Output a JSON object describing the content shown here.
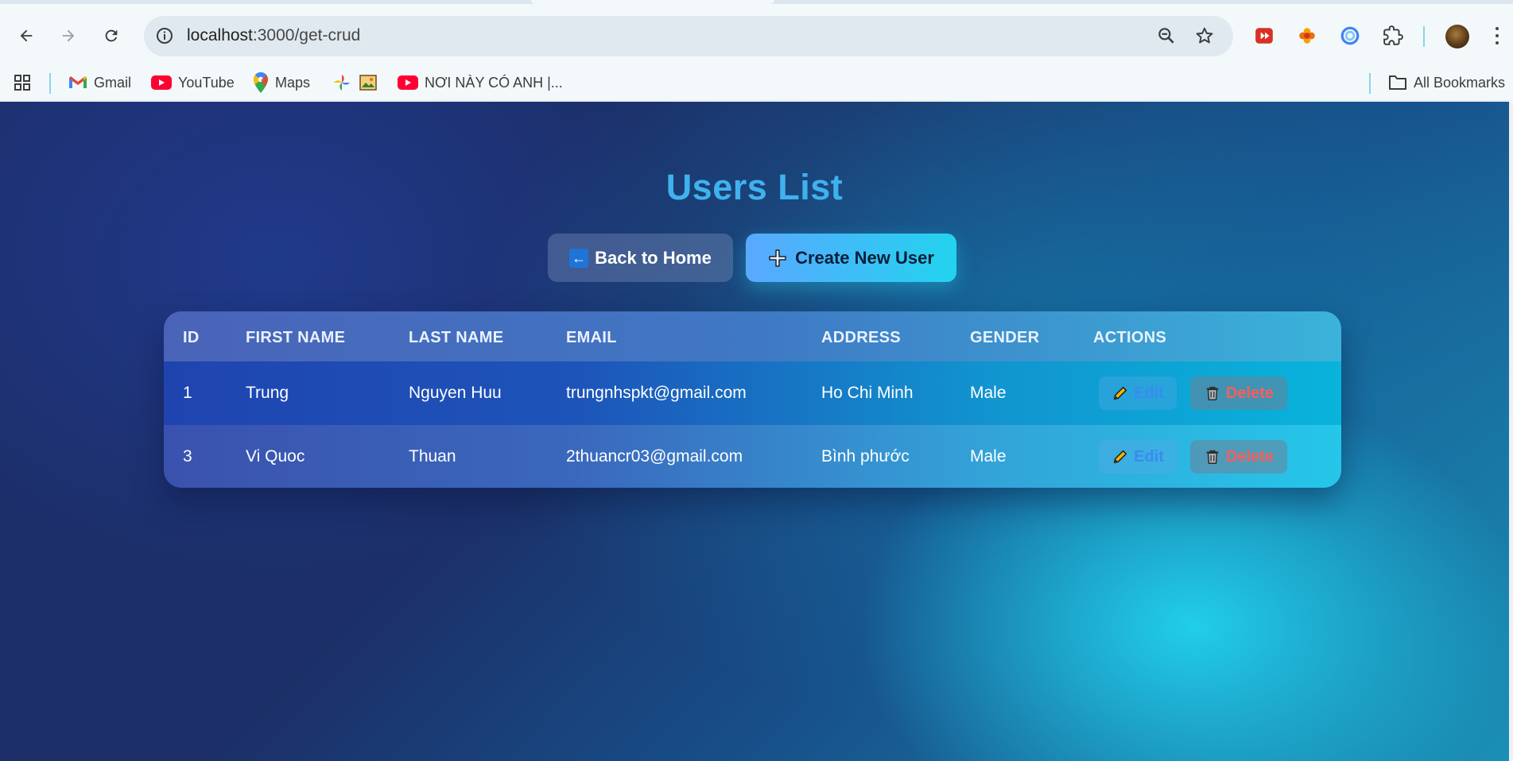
{
  "browser": {
    "url_host": "localhost",
    "url_path": ":3000/get-crud",
    "icons": {
      "back": "back-arrow-icon",
      "forward": "forward-arrow-icon",
      "reload": "reload-icon",
      "site_info": "info-icon",
      "zoom": "zoom-icon",
      "bookmark": "star-icon",
      "extensions": "puzzle-icon",
      "menu": "kebab-icon"
    }
  },
  "bookmarks": {
    "items": [
      {
        "label": "Gmail",
        "icon": "gmail-icon"
      },
      {
        "label": "YouTube",
        "icon": "youtube-icon"
      },
      {
        "label": "Maps",
        "icon": "maps-icon"
      },
      {
        "label": "",
        "icon": "photos-icon"
      },
      {
        "label": "",
        "icon": "image-icon"
      },
      {
        "label": "NƠI NÀY CÓ ANH |...",
        "icon": "youtube-icon"
      }
    ],
    "all_bookmarks": "All Bookmarks"
  },
  "page": {
    "title": "Users List",
    "back_button": "Back to Home",
    "back_icon": "←",
    "create_button": "Create New User",
    "create_icon": "✚"
  },
  "table": {
    "headers": [
      "ID",
      "FIRST NAME",
      "LAST NAME",
      "EMAIL",
      "ADDRESS",
      "GENDER",
      "ACTIONS"
    ],
    "rows": [
      {
        "id": "1",
        "first": "Trung",
        "last": "Nguyen Huu",
        "email": "trungnhspkt@gmail.com",
        "address": "Ho Chi Minh",
        "gender": "Male"
      },
      {
        "id": "3",
        "first": "Vi Quoc",
        "last": "Thuan",
        "email": "2thuancr03@gmail.com",
        "address": "Bình phước",
        "gender": "Male"
      }
    ],
    "edit_label": "Edit",
    "delete_label": "Delete"
  },
  "colors": {
    "title": "#3fb2ee",
    "edit_text": "#3a8af0",
    "delete_text": "#ff5c5c",
    "create_gradient_start": "#5aa8ff",
    "create_gradient_end": "#22d3ee"
  }
}
